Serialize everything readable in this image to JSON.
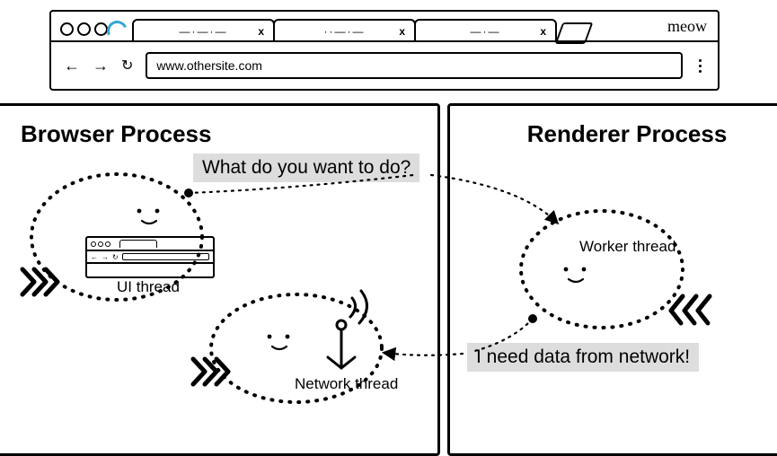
{
  "browser": {
    "meow": "meow",
    "url": "www.othersite.com",
    "tab1": "—·—·—",
    "tab2": "··—·—",
    "tab3": "—·—",
    "close": "x"
  },
  "processes": {
    "browser_title": "Browser Process",
    "renderer_title": "Renderer Process"
  },
  "threads": {
    "ui": "UI thread",
    "network": "Network thread",
    "worker": "Worker thread"
  },
  "speech": {
    "q": "What do you want to do?",
    "a": "I need data from network!"
  }
}
